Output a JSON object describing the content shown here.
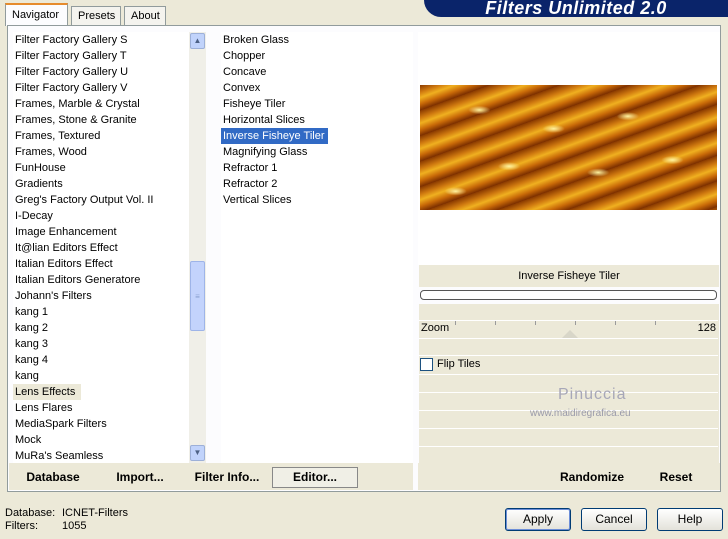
{
  "brand": "Filters Unlimited 2.0",
  "tabs": [
    {
      "label": "Navigator"
    },
    {
      "label": "Presets"
    },
    {
      "label": "About"
    }
  ],
  "categories": [
    "Filter Factory Gallery S",
    "Filter Factory Gallery T",
    "Filter Factory Gallery U",
    "Filter Factory Gallery V",
    "Frames, Marble & Crystal",
    "Frames, Stone & Granite",
    "Frames, Textured",
    "Frames, Wood",
    "FunHouse",
    "Gradients",
    "Greg's Factory Output Vol. II",
    "I-Decay",
    "Image Enhancement",
    "It@lian Editors Effect",
    "Italian Editors Effect",
    "Italian Editors Generatore",
    "Johann's Filters",
    "kang 1",
    "kang 2",
    "kang 3",
    "kang 4",
    "kang",
    "Lens Effects",
    "Lens Flares",
    "MediaSpark Filters",
    "Mock",
    "MuRa's Seamless"
  ],
  "selected_category": "Lens Effects",
  "filters": [
    "Broken Glass",
    "Chopper",
    "Concave",
    "Convex",
    "Fisheye Tiler",
    "Horizontal Slices",
    "Inverse Fisheye Tiler",
    "Magnifying Glass",
    "Refractor 1",
    "Refractor 2",
    "Vertical Slices"
  ],
  "selected_filter": "Inverse Fisheye Tiler",
  "preview": {
    "filter_name": "Inverse Fisheye Tiler"
  },
  "settings": {
    "zoom_label": "Zoom",
    "zoom_value": "128",
    "flip_tiles_label": "Flip Tiles",
    "flip_tiles_checked": false
  },
  "watermark": {
    "line1": "Pinuccia",
    "line2": "www.maidiregrafica.eu"
  },
  "toolbar": {
    "database": "Database",
    "import": "Import...",
    "filter_info": "Filter Info...",
    "editor": "Editor...",
    "randomize": "Randomize",
    "reset": "Reset"
  },
  "status": {
    "database_label": "Database:",
    "database_value": "ICNET-Filters",
    "filters_label": "Filters:",
    "filters_value": "1055"
  },
  "buttons": {
    "apply": "Apply",
    "cancel": "Cancel",
    "help": "Help"
  }
}
